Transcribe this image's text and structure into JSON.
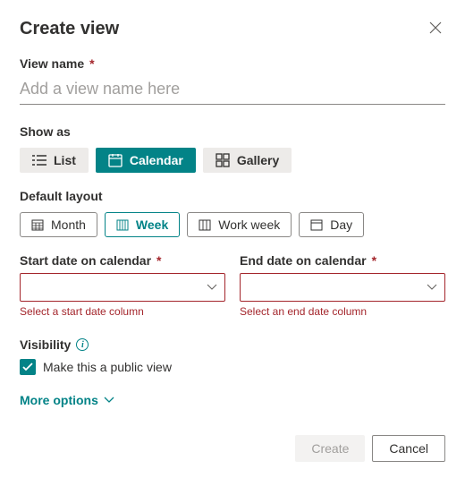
{
  "dialog": {
    "title": "Create view",
    "viewName": {
      "label": "View name",
      "placeholder": "Add a view name here",
      "value": ""
    },
    "showAs": {
      "label": "Show as",
      "options": [
        {
          "id": "list",
          "label": "List",
          "icon": "list-icon",
          "active": false
        },
        {
          "id": "calendar",
          "label": "Calendar",
          "icon": "calendar-icon",
          "active": true
        },
        {
          "id": "gallery",
          "label": "Gallery",
          "icon": "gallery-icon",
          "active": false
        }
      ]
    },
    "defaultLayout": {
      "label": "Default layout",
      "options": [
        {
          "id": "month",
          "label": "Month",
          "icon": "month-icon",
          "active": false
        },
        {
          "id": "week",
          "label": "Week",
          "icon": "week-icon",
          "active": true
        },
        {
          "id": "workweek",
          "label": "Work week",
          "icon": "workweek-icon",
          "active": false
        },
        {
          "id": "day",
          "label": "Day",
          "icon": "day-icon",
          "active": false
        }
      ]
    },
    "startDate": {
      "label": "Start date on calendar",
      "error": "Select a start date column",
      "value": ""
    },
    "endDate": {
      "label": "End date on calendar",
      "error": "Select an end date column",
      "value": ""
    },
    "visibility": {
      "label": "Visibility",
      "checkboxLabel": "Make this a public view",
      "checked": true
    },
    "moreOptions": "More options",
    "buttons": {
      "create": "Create",
      "cancel": "Cancel"
    }
  }
}
